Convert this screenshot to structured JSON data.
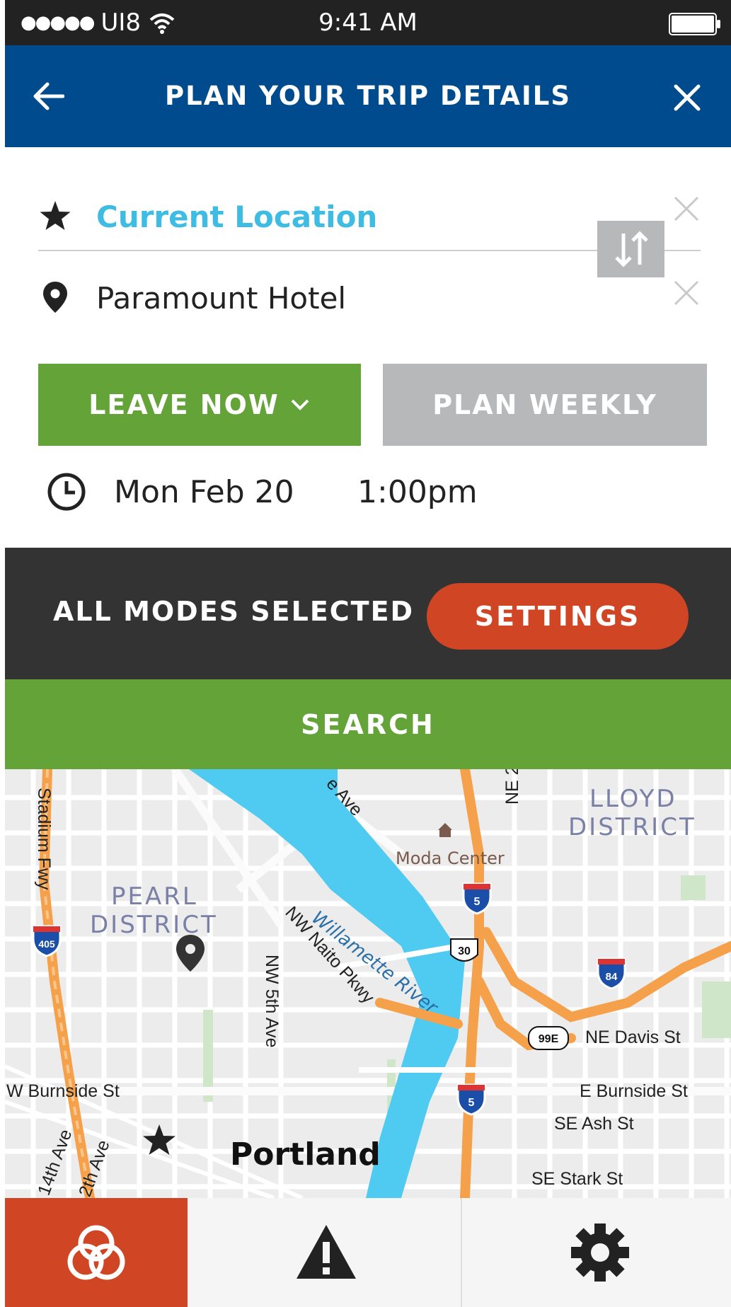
{
  "status_bar": {
    "carrier": "UI8",
    "time": "9:41 AM"
  },
  "header": {
    "title": "PLAN YOUR TRIP DETAILS"
  },
  "trip": {
    "from": "Current Location",
    "to": "Paramount Hotel",
    "leave_label": "LEAVE NOW",
    "plan_weekly_label": "PLAN WEEKLY",
    "date": "Mon Feb 20",
    "time": "1:00pm"
  },
  "modes": {
    "label": "ALL MODES SELECTED",
    "settings_label": "SETTINGS"
  },
  "search_label": "SEARCH",
  "map": {
    "districts": [
      "LLOYD",
      "DISTRICT",
      "PEARL",
      "DISTRICT"
    ],
    "city": "Portland",
    "poi": "Moda Center",
    "river": "Willamette River",
    "streets": [
      "Stadium Fwy",
      "NW Naito Pkwy",
      "NW 5th Ave",
      "W Burnside St",
      "NE Davis St",
      "E Burnside St",
      "SE Ash St",
      "SE Stark St",
      "14th Ave",
      "2th Ave",
      "e Ave",
      "NE 2"
    ],
    "shields": [
      "405",
      "5",
      "30",
      "84",
      "99E",
      "5"
    ]
  },
  "colors": {
    "header_blue": "#004b8d",
    "accent_green": "#63a338",
    "accent_red": "#d04524",
    "link_blue": "#3fbce3",
    "dark_bar": "#333333",
    "neutral_gray": "#b6b8ba"
  },
  "icons": {
    "back": "arrow-left-icon",
    "close": "close-icon",
    "from": "star-icon",
    "to": "map-pin-icon",
    "swap": "swap-vertical-icon",
    "clock": "clock-icon",
    "tab_trip": "trip-planner-icon",
    "tab_alerts": "alert-triangle-icon",
    "tab_settings": "gear-icon"
  }
}
